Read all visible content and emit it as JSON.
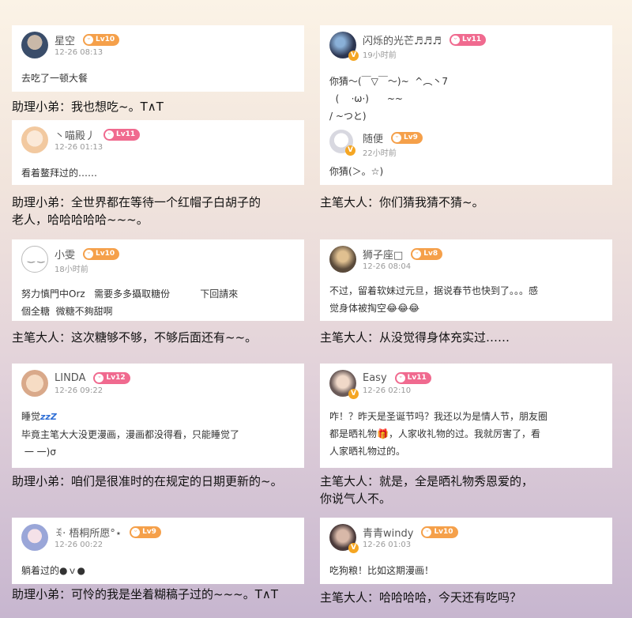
{
  "left": [
    {
      "user": {
        "name": "星空",
        "level": "Lv10",
        "badge_color": "orange",
        "time": "12-26 08:13",
        "avatar_color": "#3a4d6a"
      },
      "content": "去吃了一顿大餐",
      "caption": "助理小弟：我也想吃~。T∧T"
    },
    {
      "user": {
        "name": "丶喵殿丿",
        "level": "Lv11",
        "badge_color": "pink",
        "time": "12-26 01:13",
        "avatar_color": "#f2d7b8"
      },
      "content": "看着鳌拜过的……",
      "caption": "助理小弟：全世界都在等待一个红帽子白胡子的\n老人，哈哈哈哈哈~~~。"
    },
    {
      "user": {
        "name": "小雯",
        "level": "Lv10",
        "badge_color": "orange",
        "time": "18小时前",
        "avatar_color": "#ffffff"
      },
      "content": "努力慎門中Orz   需要多多攝取糖份          下回請來\n個全糖  微糖不夠甜啊",
      "caption": "主笔大人：这次糖够不够，不够后面还有~~。"
    },
    {
      "user": {
        "name": "LINDA",
        "level": "Lv12",
        "badge_color": "pink",
        "time": "12-26 09:22",
        "avatar_color": "#e9c8a8"
      },
      "content_prefix": "睡觉",
      "zzz": "zzZ",
      "content": "毕竟主笔大大没更漫画，漫画都没得看，只能睡觉了\n 一 一)σ",
      "caption": "助理小弟：咱们是很准时的在规定的日期更新的~。"
    },
    {
      "user": {
        "name": "ꉂ· 梧桐所愿°⋆",
        "level": "Lv9",
        "badge_color": "orange",
        "time": "12-26 00:22",
        "avatar_color": "#9aa6d8"
      },
      "content": "躺着过的●ｖ●",
      "caption": "助理小弟：可怜的我是坐着糊稿子过的~~~。T∧T"
    }
  ],
  "right": [
    {
      "user": {
        "name": "闪烁的光芒♬♬♬",
        "level": "Lv11",
        "badge_color": "pink",
        "time": "19小时前",
        "avatar_color": "#2c3550"
      },
      "content": "你猜～(￣▽￣～)~  ^︵丶7\n  (    ·ω·)      ~~\n/ ~つと)",
      "reply": {
        "name": "随便",
        "level": "Lv9",
        "badge_color": "orange",
        "time": "22小时前",
        "avatar_color": "#e8e8ee"
      },
      "reply_content": "你猜(＞。☆)",
      "caption": "主笔大人：你们猜我猜不猜~。"
    },
    {
      "user": {
        "name": "狮子座□",
        "level": "Lv8",
        "badge_color": "orange",
        "time": "12-26 08:04",
        "avatar_color": "#5a4a3a"
      },
      "content": "不过，留着软妹过元旦，据说春节也快到了。。。感\n觉身体被掏空😂😂😂",
      "caption": "主笔大人：从没觉得身体充实过……"
    },
    {
      "user": {
        "name": "Easy",
        "level": "Lv11",
        "badge_color": "pink",
        "time": "12-26 02:10",
        "avatar_color": "#6a5a58"
      },
      "content": "咋！？昨天是圣诞节吗？我还以为是情人节，朋友圈\n都是晒礼物🎁，人家收礼物的过。我就厉害了，看\n人家晒礼物过的。",
      "caption": "主笔大人：就是，全是晒礼物秀恩爱的，\n你说气人不。"
    },
    {
      "user": {
        "name": "青青windy",
        "level": "Lv10",
        "badge_color": "orange",
        "time": "12-26 01:03",
        "avatar_color": "#4a3a3a"
      },
      "content": "吃狗粮！比如这期漫画！",
      "caption": "主笔大人：哈哈哈哈，今天还有吃吗？"
    }
  ],
  "icons": {
    "badge_icon": "peach-face-icon",
    "verified_icon": "v-badge-icon"
  }
}
